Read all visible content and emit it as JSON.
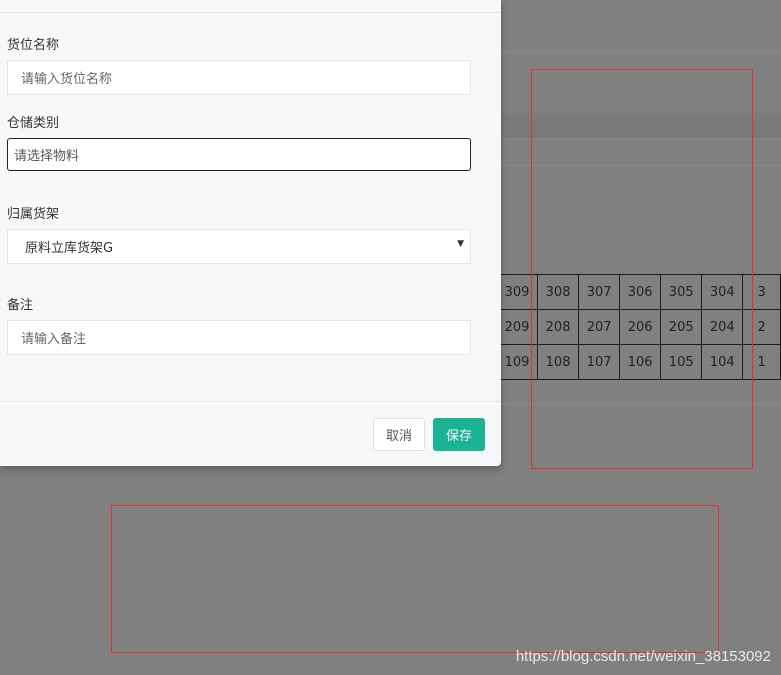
{
  "form": {
    "location_name": {
      "label": "货位名称",
      "placeholder": "请输入货位名称"
    },
    "storage_category": {
      "label": "仓储类别",
      "placeholder": "请选择物料"
    },
    "shelf": {
      "label": "归属货架",
      "selected": "原料立库货架G"
    },
    "remarks": {
      "label": "备注",
      "placeholder": "请输入备注"
    }
  },
  "buttons": {
    "cancel": "取消",
    "save": "保存"
  },
  "background_grid": {
    "rows": [
      [
        "309",
        "308",
        "307",
        "306",
        "305",
        "304",
        "3"
      ],
      [
        "209",
        "208",
        "207",
        "206",
        "205",
        "204",
        "2"
      ],
      [
        "109",
        "108",
        "107",
        "106",
        "105",
        "104",
        "1"
      ]
    ]
  },
  "watermark": "https://blog.csdn.net/weixin_38153092",
  "colors": {
    "primary": "#1ab394",
    "overlay": "#808080",
    "annotation": "#e03030"
  }
}
